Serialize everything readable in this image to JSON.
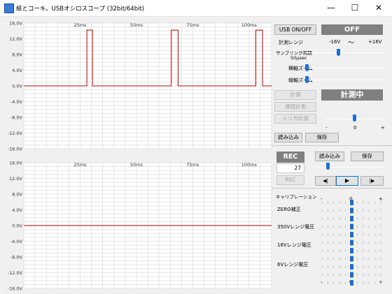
{
  "window": {
    "title": "紙とコーキ。USBオシロスコープ (32bit/64bit)",
    "minimize": "—",
    "maximize": "☐",
    "close": "✕"
  },
  "scope": {
    "time_ticks": [
      "25ms",
      "50ms",
      "75ms",
      "100ms"
    ],
    "y_ticks": [
      "16.0V",
      "12.0V",
      "8.0V",
      "4.0V",
      "0.0V",
      "-4.0V",
      "-8.0V",
      "-12.0V",
      "-16.0V"
    ],
    "trace_color": "#c00000",
    "grid_color": "#dcdcdc",
    "ylim": [
      -16,
      16
    ],
    "xlim_ms": [
      0,
      110
    ],
    "top_trace_pulses": [
      {
        "start_ms": 28,
        "end_ms": 30.5,
        "high_v": 14.2,
        "low_v": 0
      },
      {
        "start_ms": 65.5,
        "end_ms": 68.5,
        "high_v": 14.2,
        "low_v": 0
      },
      {
        "start_ms": 103,
        "end_ms": 106,
        "high_v": 14.2,
        "low_v": 0
      }
    ],
    "bottom_trace_level_v": 0
  },
  "controls": {
    "usb_btn": "USB ON/OFF",
    "usb_status": "OFF",
    "range_label": "計測レンジ",
    "range_min": "-16V",
    "range_tilde": "〜",
    "range_max": "+16V",
    "sampling_label": "サンプリング周期",
    "sampling_value": "50μsec",
    "hzoom_label": "横軸ズーム",
    "vzoom_label": "縦軸ズーム",
    "measure_btn": "計測",
    "continuous_btn": "連続計測",
    "trigger_btn": "トリガ計測",
    "measuring_status": "計測中",
    "trigger_scale": [
      "-",
      "0",
      "+"
    ],
    "load_btn": "読み込み",
    "save_btn": "保存",
    "rec_status": "REC",
    "rec_load_btn": "読み込み",
    "rec_save_btn": "保存",
    "rec_count": "27",
    "rec_btn": "REC",
    "prev_btn": "◀|",
    "play_btn": "▶",
    "next_btn": "|▶",
    "cal_label": "キャリブレーション",
    "cal_scale_top": [
      "-",
      "0",
      "+"
    ],
    "zero_label": "ZERO補正",
    "r350_label": "350Vレンジ電圧",
    "r16_label": "16Vレンジ電圧",
    "r6_label": "6Vレンジ電圧",
    "cal_scale_bottom": [
      "-",
      "0",
      "+"
    ]
  }
}
